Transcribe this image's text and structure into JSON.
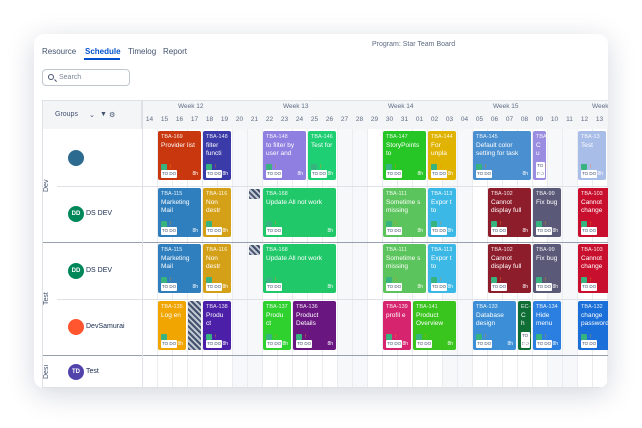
{
  "tabs": [
    "Resource",
    "Schedule",
    "Timelog",
    "Report"
  ],
  "program_title": "Program: Star Team Board",
  "search": {
    "placeholder": "Search"
  },
  "groups_label": "Groups",
  "weeks": [
    "Week 12",
    "Week 13",
    "Week 14",
    "Week 15",
    "Week"
  ],
  "days": [
    "14",
    "15",
    "16",
    "17",
    "18",
    "19",
    "20",
    "21",
    "22",
    "23",
    "24",
    "25",
    "26",
    "27",
    "28",
    "29",
    "30",
    "31",
    "01",
    "02",
    "03",
    "04",
    "05",
    "06",
    "07",
    "08",
    "09",
    "10",
    "11",
    "12",
    "13",
    "14"
  ],
  "sections": [
    {
      "label": "Dev",
      "members": [
        {
          "name": "",
          "initials": "",
          "avatar_color": "#2d6a8f"
        },
        {
          "name": "DS DEV",
          "initials": "DD",
          "avatar_color": "#00875a"
        }
      ]
    },
    {
      "label": "Test",
      "members": [
        {
          "name": "DS DEV",
          "initials": "DD",
          "avatar_color": "#00875a"
        },
        {
          "name": "DevSamurai",
          "initials": "",
          "avatar_color": "#ff5630"
        }
      ]
    },
    {
      "label": "Desi",
      "members": [
        {
          "name": "Test",
          "initials": "TD",
          "avatar_color": "#5243aa"
        }
      ]
    }
  ],
  "tasks": [
    {
      "row": 0,
      "col": 1,
      "span": 3,
      "color": "#c9370e",
      "key": "TBA-169",
      "title": "Provider list",
      "status": "TO DO",
      "hours": "8h"
    },
    {
      "row": 0,
      "col": 4,
      "span": 2,
      "color": "#3a3aa8",
      "key": "TBA-148",
      "title": "filter functi",
      "status": "TO DO",
      "hours": "8h"
    },
    {
      "row": 0,
      "col": 8,
      "span": 3,
      "color": "#8f7fe0",
      "key": "TBA-148",
      "title": "to filter by user and",
      "status": "TO DO",
      "hours": "8h"
    },
    {
      "row": 0,
      "col": 11,
      "span": 2,
      "color": "#1fcf74",
      "key": "TBA-146",
      "title": "Test for",
      "status": "TO DO",
      "hours": "8h"
    },
    {
      "row": 0,
      "col": 16,
      "span": 3,
      "color": "#27c627",
      "key": "TBA-147",
      "title": "StoryPoints to",
      "status": "TO DO",
      "hours": "8h"
    },
    {
      "row": 0,
      "col": 19,
      "span": 2,
      "color": "#e0b300",
      "key": "TBA-144",
      "title": "For unpla",
      "status": "TO DO",
      "hours": "8h"
    },
    {
      "row": 0,
      "col": 22,
      "span": 4,
      "color": "#4a8fcf",
      "key": "TBA-145",
      "title": "Default color setting for task",
      "status": "TO DO",
      "hours": "8h"
    },
    {
      "row": 0,
      "col": 26,
      "span": 1,
      "color": "#9a8ce0",
      "key": "TBA",
      "title": "C u",
      "status": "TO DO",
      "hours": "8h"
    },
    {
      "row": 0,
      "col": 29,
      "span": 2,
      "color": "#a9bde9",
      "key": "TBA-13",
      "title": "Test",
      "status": "TO DO",
      "hours": "8h"
    },
    {
      "row": 0,
      "col": 31,
      "span": 1,
      "color": "#0b9e73",
      "key": "TBA",
      "title": "",
      "status": "TO DO",
      "hours": "8h"
    },
    {
      "row": 1,
      "col": 1,
      "span": 3,
      "color": "#2f7fbf",
      "key": "TBA-115",
      "title": "Marketing Mail",
      "status": "TO DO",
      "hours": "8h"
    },
    {
      "row": 1,
      "col": 4,
      "span": 2,
      "color": "#d4a017",
      "key": "TBA-116",
      "title": "Non destr",
      "status": "TO DO",
      "hours": "8h"
    },
    {
      "row": 1,
      "col": 8,
      "span": 5,
      "color": "#21c86a",
      "key": "TBA-168",
      "title": "Update All not work",
      "status": "TO DO",
      "hours": "8h"
    },
    {
      "row": 1,
      "col": 16,
      "span": 3,
      "color": "#5cc45c",
      "key": "TBA-111",
      "title": "Sometime s missing",
      "status": "TO DO",
      "hours": "8h"
    },
    {
      "row": 1,
      "col": 19,
      "span": 2,
      "color": "#3cb8e6",
      "key": "TBA-113",
      "title": "Expor t to",
      "status": "TO DO",
      "hours": "8h"
    },
    {
      "row": 1,
      "col": 23,
      "span": 3,
      "color": "#8e1d2b",
      "key": "TBA-102",
      "title": "Cannot display full",
      "status": "TO DO",
      "hours": "8h"
    },
    {
      "row": 1,
      "col": 26,
      "span": 2,
      "color": "#5a5a78",
      "key": "TBA-99",
      "title": "Fix bug",
      "status": "TO DO",
      "hours": "8h"
    },
    {
      "row": 1,
      "col": 29,
      "span": 3,
      "color": "#c8102e",
      "key": "TBA-103",
      "title": "Cannot change",
      "status": "TO DO",
      "hours": "8h"
    },
    {
      "row": 2,
      "col": 1,
      "span": 3,
      "color": "#2f7fbf",
      "key": "TBA-115",
      "title": "Marketing Mail",
      "status": "TO DO",
      "hours": "8h"
    },
    {
      "row": 2,
      "col": 4,
      "span": 2,
      "color": "#d4a017",
      "key": "TBA-116",
      "title": "Non destr",
      "status": "TO DO",
      "hours": "8h"
    },
    {
      "row": 2,
      "col": 8,
      "span": 5,
      "color": "#21c86a",
      "key": "TBA-168",
      "title": "Update All not work",
      "status": "TO DO",
      "hours": "8h"
    },
    {
      "row": 2,
      "col": 16,
      "span": 3,
      "color": "#5cc45c",
      "key": "TBA-111",
      "title": "Sometime s missing",
      "status": "TO DO",
      "hours": "8h"
    },
    {
      "row": 2,
      "col": 19,
      "span": 2,
      "color": "#3cb8e6",
      "key": "TBA-113",
      "title": "Expor t to",
      "status": "TO DO",
      "hours": "8h"
    },
    {
      "row": 2,
      "col": 23,
      "span": 3,
      "color": "#8e1d2b",
      "key": "TBA-102",
      "title": "Cannot display full",
      "status": "TO DO",
      "hours": "8h"
    },
    {
      "row": 2,
      "col": 26,
      "span": 2,
      "color": "#5a5a78",
      "key": "TBA-99",
      "title": "Fix bug",
      "status": "TO DO",
      "hours": "8h"
    },
    {
      "row": 2,
      "col": 29,
      "span": 3,
      "color": "#c8102e",
      "key": "TBA-103",
      "title": "Cannot change",
      "status": "TO DO",
      "hours": "8h"
    },
    {
      "row": 3,
      "col": 1,
      "span": 2,
      "color": "#f0a500",
      "key": "TBA-135",
      "title": "Log en",
      "status": "TO DO",
      "hours": "8h"
    },
    {
      "row": 3,
      "col": 4,
      "span": 2,
      "color": "#4b1fa8",
      "key": "TBA-138",
      "title": "Produ ct",
      "status": "TO DO",
      "hours": "8h"
    },
    {
      "row": 3,
      "col": 8,
      "span": 2,
      "color": "#2fd12f",
      "key": "TBA-137",
      "title": "Produ ct",
      "status": "TO DO",
      "hours": "8h"
    },
    {
      "row": 3,
      "col": 10,
      "span": 3,
      "color": "#6a1680",
      "key": "TBA-136",
      "title": "Product Details",
      "status": "TO DO",
      "hours": "8h"
    },
    {
      "row": 3,
      "col": 16,
      "span": 2,
      "color": "#d6246e",
      "key": "TBA-139",
      "title": "profil e",
      "status": "TO DO",
      "hours": "8h"
    },
    {
      "row": 3,
      "col": 18,
      "span": 3,
      "color": "#39c51d",
      "key": "TBA-141",
      "title": "Product Overview",
      "status": "TO DO",
      "hours": "8h"
    },
    {
      "row": 3,
      "col": 22,
      "span": 3,
      "color": "#3c8fd6",
      "key": "TBA-133",
      "title": "Database design",
      "status": "TO DO",
      "hours": "8h"
    },
    {
      "row": 3,
      "col": 25,
      "span": 1,
      "color": "#0f6e35",
      "key": "EC-",
      "title": "C h",
      "status": "TO DO",
      "hours": "8h"
    },
    {
      "row": 3,
      "col": 26,
      "span": 2,
      "color": "#2a7fe0",
      "key": "TBA-134",
      "title": "Hide menu",
      "status": "TO DO",
      "hours": "8h"
    },
    {
      "row": 3,
      "col": 29,
      "span": 3,
      "color": "#1a6fd8",
      "key": "TBA-132",
      "title": "change password",
      "status": "TO DO",
      "hours": "8h"
    }
  ]
}
